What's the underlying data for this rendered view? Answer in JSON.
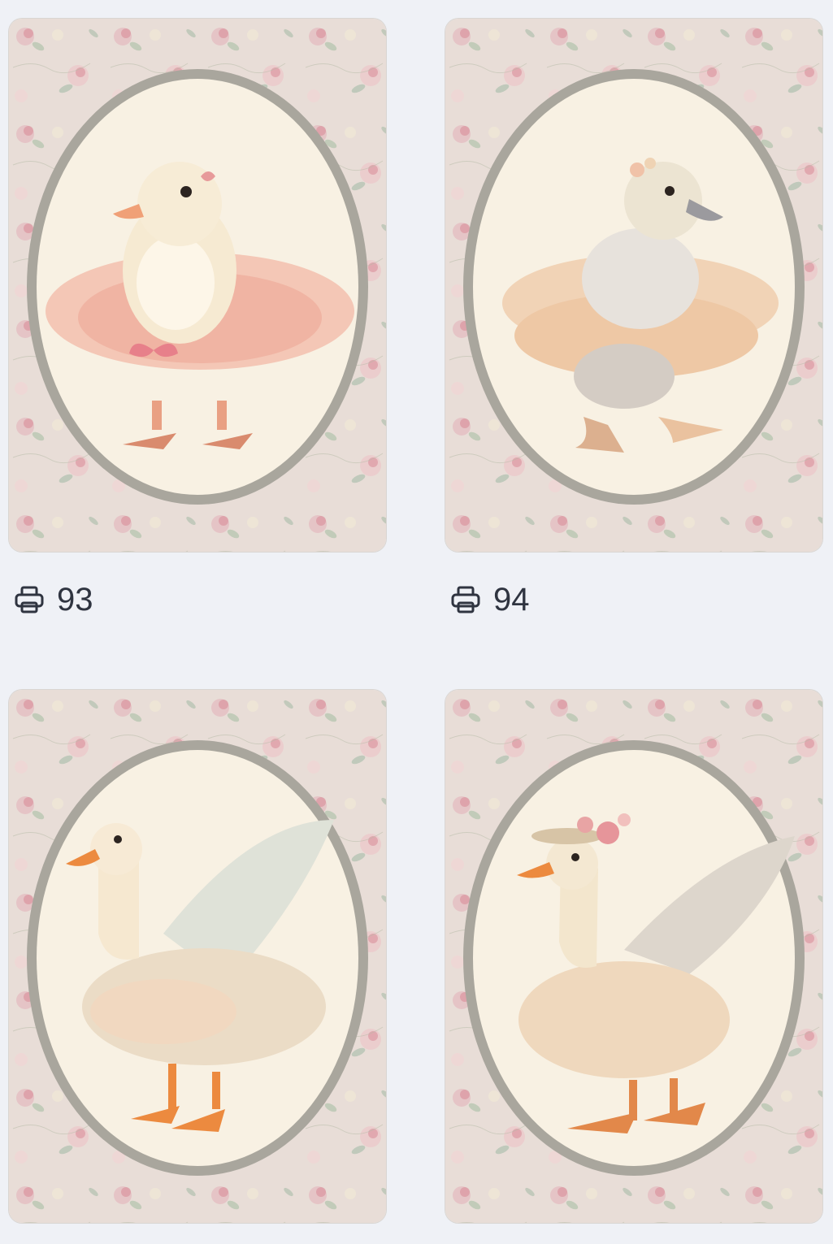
{
  "cards": [
    {
      "subject": "duckling-in-pink-tutu",
      "print_count": "93",
      "print_icon": "printer-icon",
      "frame_color": "#a9a69d",
      "oval_color": "#f8f1e3",
      "paper_color": "#e9dfd9"
    },
    {
      "subject": "gray-gosling-ballerina",
      "print_count": "94",
      "print_icon": "printer-icon",
      "frame_color": "#a9a69d",
      "oval_color": "#f8f1e3",
      "paper_color": "#e9dfd9"
    },
    {
      "subject": "goose-with-wings-in-tutu",
      "print_icon": "printer-icon",
      "frame_color": "#a9a69d",
      "oval_color": "#f8f1e3",
      "paper_color": "#e9dfd9"
    },
    {
      "subject": "goose-with-flower-hat",
      "print_icon": "printer-icon",
      "frame_color": "#a9a69d",
      "oval_color": "#f8f1e3",
      "paper_color": "#e9dfd9"
    }
  ]
}
